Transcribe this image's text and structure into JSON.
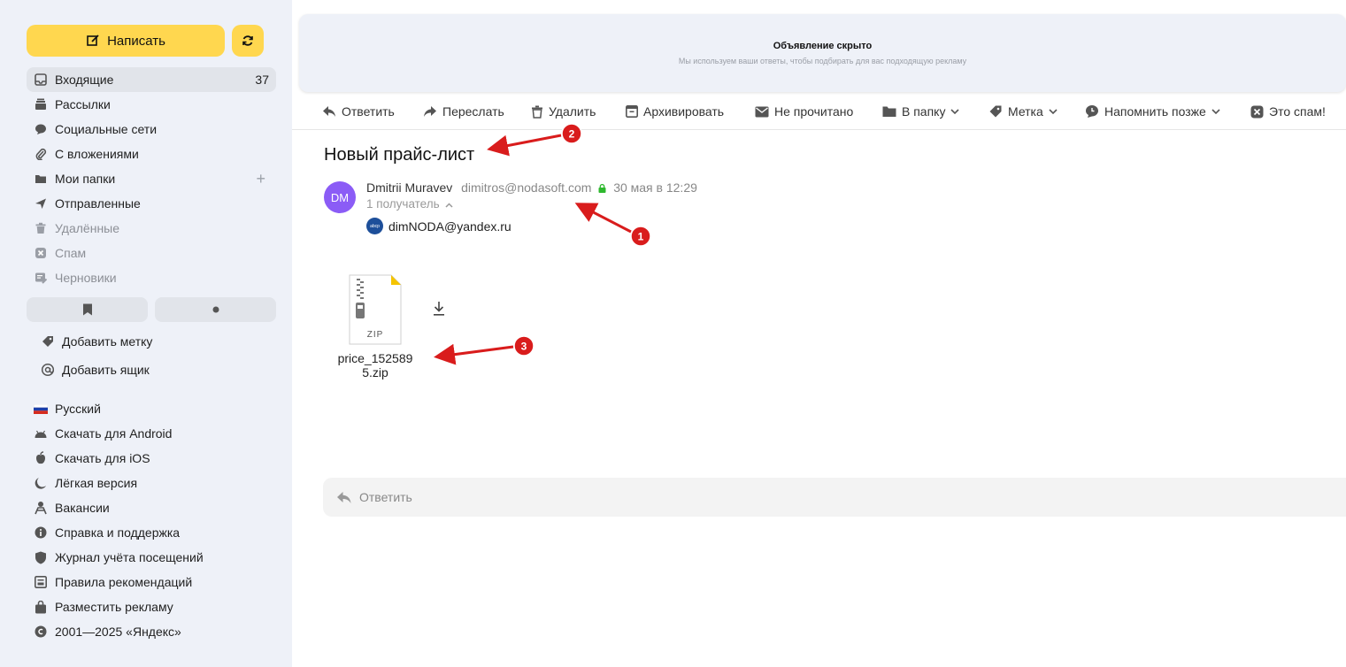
{
  "compose": {
    "label": "Написать"
  },
  "nav": [
    {
      "label": "Входящие",
      "count": "37",
      "icon": "inbox-icon"
    },
    {
      "label": "Рассылки",
      "icon": "newsletters-icon"
    },
    {
      "label": "Социальные сети",
      "icon": "social-icon"
    },
    {
      "label": "С вложениями",
      "icon": "paperclip-icon"
    },
    {
      "label": "Мои папки",
      "icon": "folder-icon"
    },
    {
      "label": "Отправленные",
      "icon": "send-icon"
    },
    {
      "label": "Удалённые",
      "icon": "trash-icon"
    },
    {
      "label": "Спам",
      "icon": "spam-icon"
    },
    {
      "label": "Черновики",
      "icon": "drafts-icon"
    }
  ],
  "extra": {
    "add_label": "Добавить метку",
    "add_box": "Добавить ящик"
  },
  "footer": [
    {
      "label": "Русский",
      "icon": "russian-flag-icon"
    },
    {
      "label": "Скачать для Android",
      "icon": "android-icon"
    },
    {
      "label": "Скачать для iOS",
      "icon": "apple-icon"
    },
    {
      "label": "Лёгкая версия",
      "icon": "moon-icon"
    },
    {
      "label": "Вакансии",
      "icon": "vacancies-icon"
    },
    {
      "label": "Справка и поддержка",
      "icon": "info-icon"
    },
    {
      "label": "Журнал учёта посещений",
      "icon": "shield-icon"
    },
    {
      "label": "Правила рекомендаций",
      "icon": "rules-icon"
    },
    {
      "label": "Разместить рекламу",
      "icon": "bag-icon"
    },
    {
      "label": "2001—2025 «Яндекс»",
      "icon": "copyright-icon"
    }
  ],
  "ad": {
    "title": "Объявление скрыто",
    "subtitle": "Мы используем ваши ответы, чтобы подбирать для вас подходящую рекламу"
  },
  "toolbar": {
    "reply": "Ответить",
    "forward": "Переслать",
    "delete": "Удалить",
    "archive": "Архивировать",
    "unread": "Не прочитано",
    "to_folder": "В папку",
    "label": "Метка",
    "remind": "Напомнить позже",
    "spam": "Это спам!"
  },
  "message": {
    "subject": "Новый прайс-лист",
    "avatar": "DM",
    "sender_name": "Dmitrii Muravev",
    "sender_email": "dimitros@nodasoft.com",
    "date": "30 мая в 12:29",
    "recipients_count": "1 получатель",
    "recipient_avatar": "abcp",
    "recipient": "dimNODA@yandex.ru",
    "attachment_type": "ZIP",
    "attachment_name_line1": "price_152589",
    "attachment_name_line2": "5.zip"
  },
  "reply_box": {
    "label": "Ответить"
  },
  "annotations": [
    "1",
    "2",
    "3"
  ],
  "colors": {
    "compose": "#ffd74f",
    "avatar": "#8b5cf6",
    "annotation": "#d91c1c"
  }
}
